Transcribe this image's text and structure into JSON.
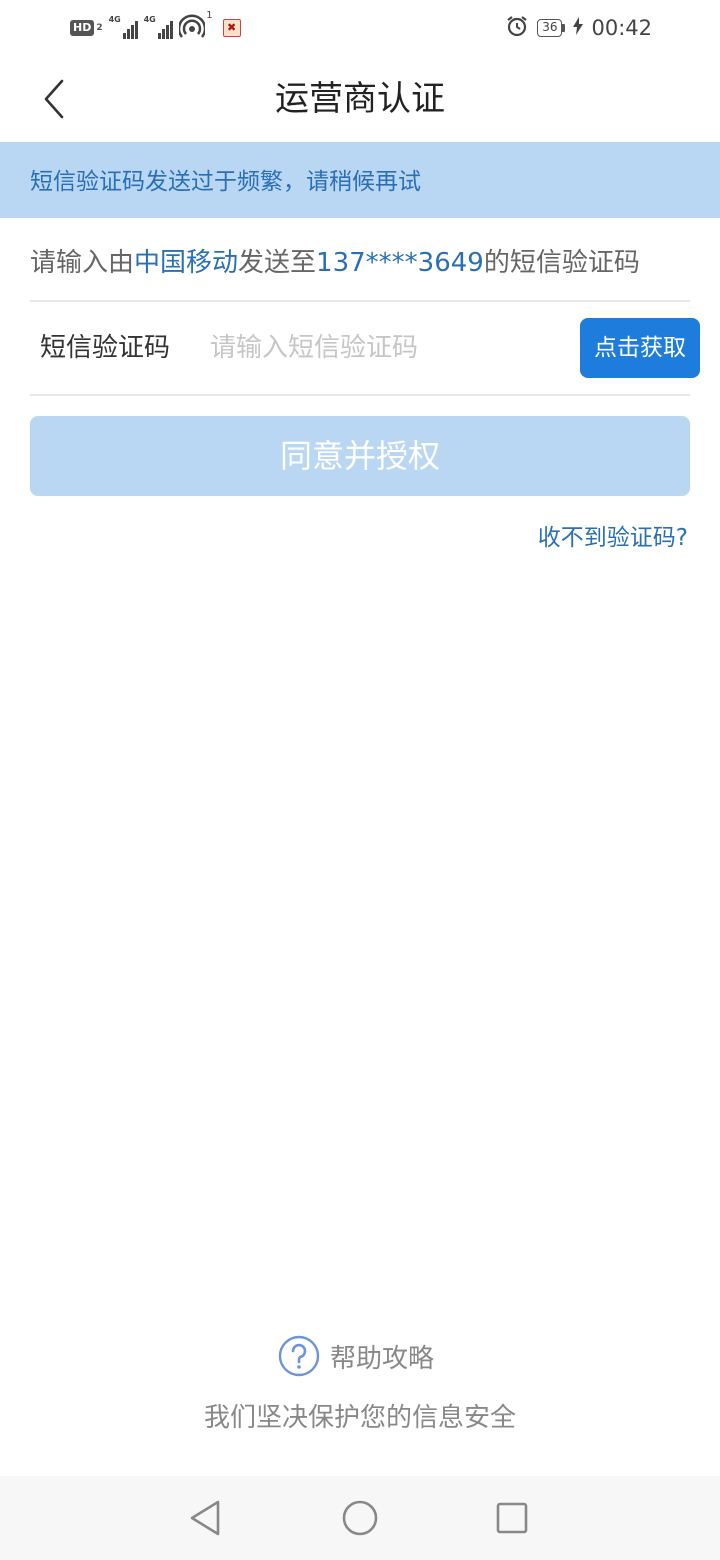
{
  "status_bar": {
    "hd_label": "HD",
    "hd_sub": "2",
    "sim1_network": "4G",
    "sim2_network": "4G",
    "hotspot_badge": "1",
    "battery_level": "36",
    "time": "00:42"
  },
  "header": {
    "title": "运营商认证"
  },
  "banner": {
    "message": "短信验证码发送过于频繁，请稍候再试"
  },
  "info": {
    "prefix": "请输入由",
    "carrier": "中国移动",
    "middle": "发送至",
    "phone": "137****3649",
    "suffix": "的短信验证码"
  },
  "form": {
    "code_label": "短信验证码",
    "code_value": "",
    "code_placeholder": "请输入短信验证码",
    "get_code_button": "点击获取",
    "agree_button": "同意并授权",
    "no_code_link": "收不到验证码?"
  },
  "footer": {
    "help_label": "帮助攻略",
    "secure_text": "我们坚决保护您的信息安全"
  },
  "colors": {
    "accent": "#1e7ddc",
    "link": "#2a6fb5",
    "banner_bg": "#b9d7f3",
    "disabled_button": "#b9d7f3"
  },
  "icons": {
    "back": "chevron-left-icon",
    "help": "question-circle-icon",
    "alarm": "alarm-icon",
    "charging": "bolt-icon"
  }
}
